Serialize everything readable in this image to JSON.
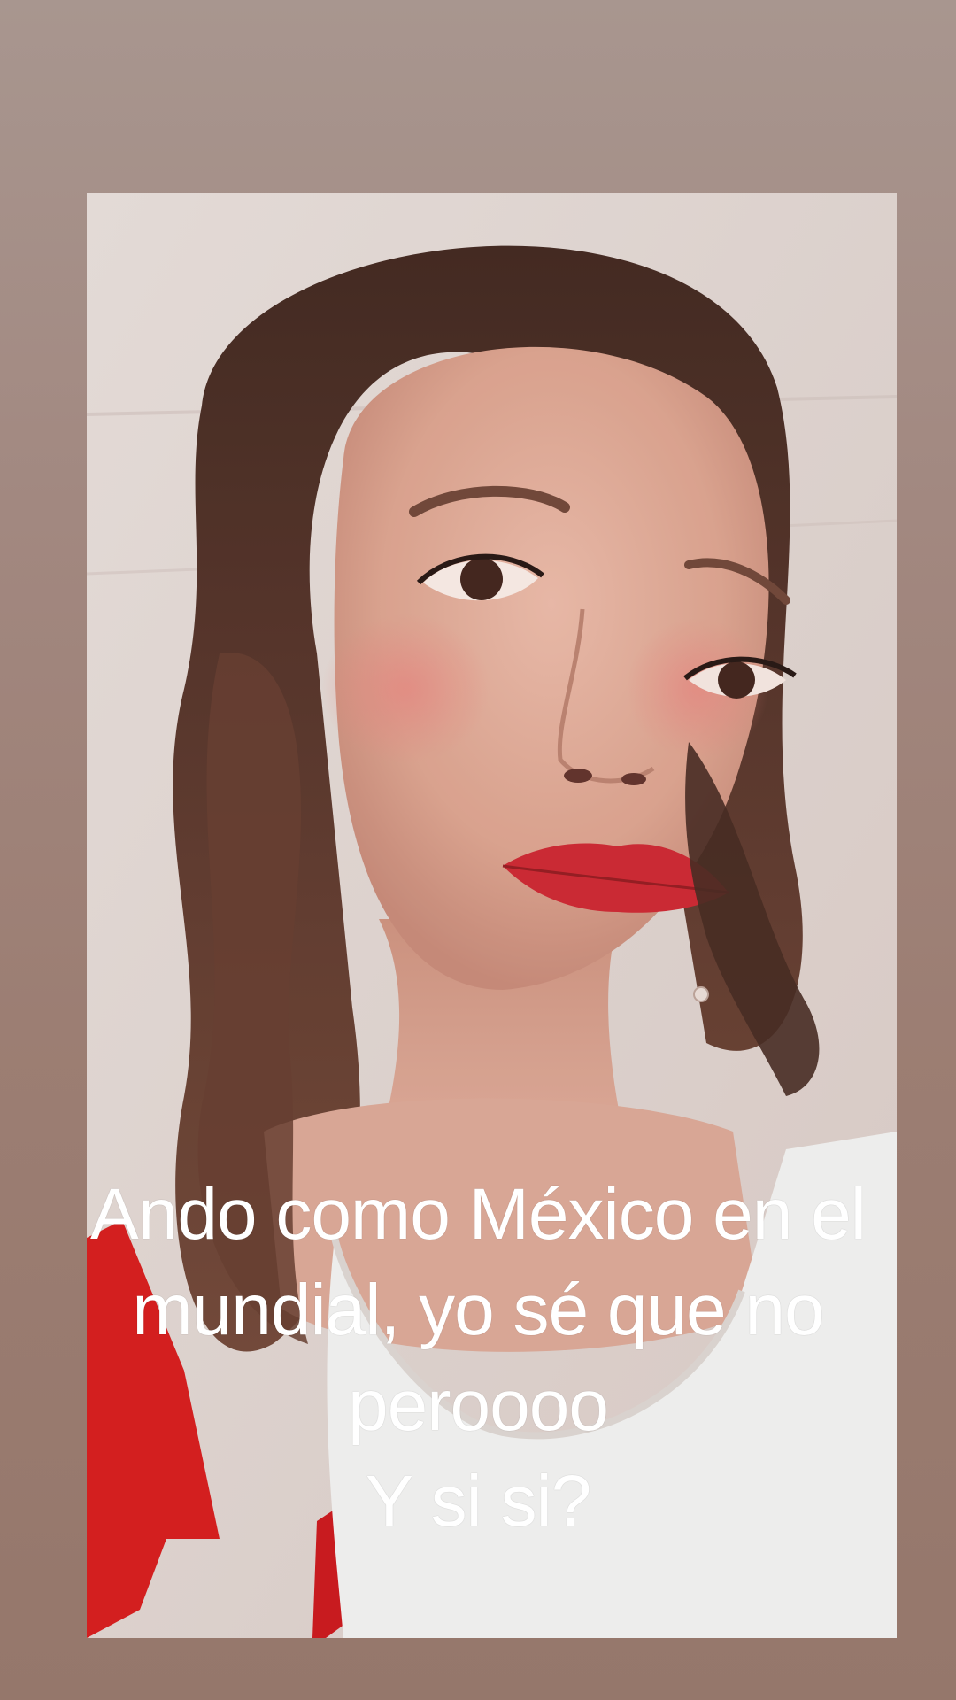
{
  "story": {
    "caption_lines": [
      "Ando como México en el",
      "mundial, yo sé que no",
      "peroooo",
      "Y si si?"
    ]
  },
  "colors": {
    "background": "#a28880",
    "photo_background": "#d8ccc8",
    "hair": "#4a2a1f",
    "skin": "#d7a08d",
    "lips": "#c81f2a",
    "shirt": "#ededeb",
    "red_fabric": "#d11414",
    "caption_text": "#ffffff"
  },
  "icons": {
    "photo": "portrait-photo"
  }
}
